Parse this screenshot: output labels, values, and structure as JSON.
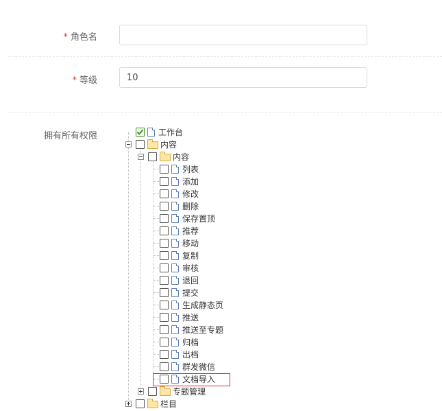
{
  "form": {
    "role_name": {
      "label": "角色名",
      "required_mark": "*",
      "value": "",
      "placeholder": ""
    },
    "level": {
      "label": "等级",
      "required_mark": "*",
      "value": "10"
    },
    "permissions": {
      "label": "拥有所有权限"
    }
  },
  "tree": {
    "workbench": {
      "label": "工作台",
      "checked": true
    },
    "content_root": {
      "label": "内容"
    },
    "content": {
      "label": "内容"
    },
    "items": [
      "列表",
      "添加",
      "修改",
      "删除",
      "保存置顶",
      "推荐",
      "移动",
      "复制",
      "审核",
      "退回",
      "提交",
      "生成静态页",
      "推送",
      "推送至专题",
      "归档",
      "出档",
      "群发微信",
      "文档导入"
    ],
    "topics": {
      "label": "专题管理"
    },
    "columns": {
      "label": "栏目"
    }
  },
  "colors": {
    "required": "#e4393c",
    "highlight_border": "#dd2222",
    "checked": "#2f9a1b"
  }
}
